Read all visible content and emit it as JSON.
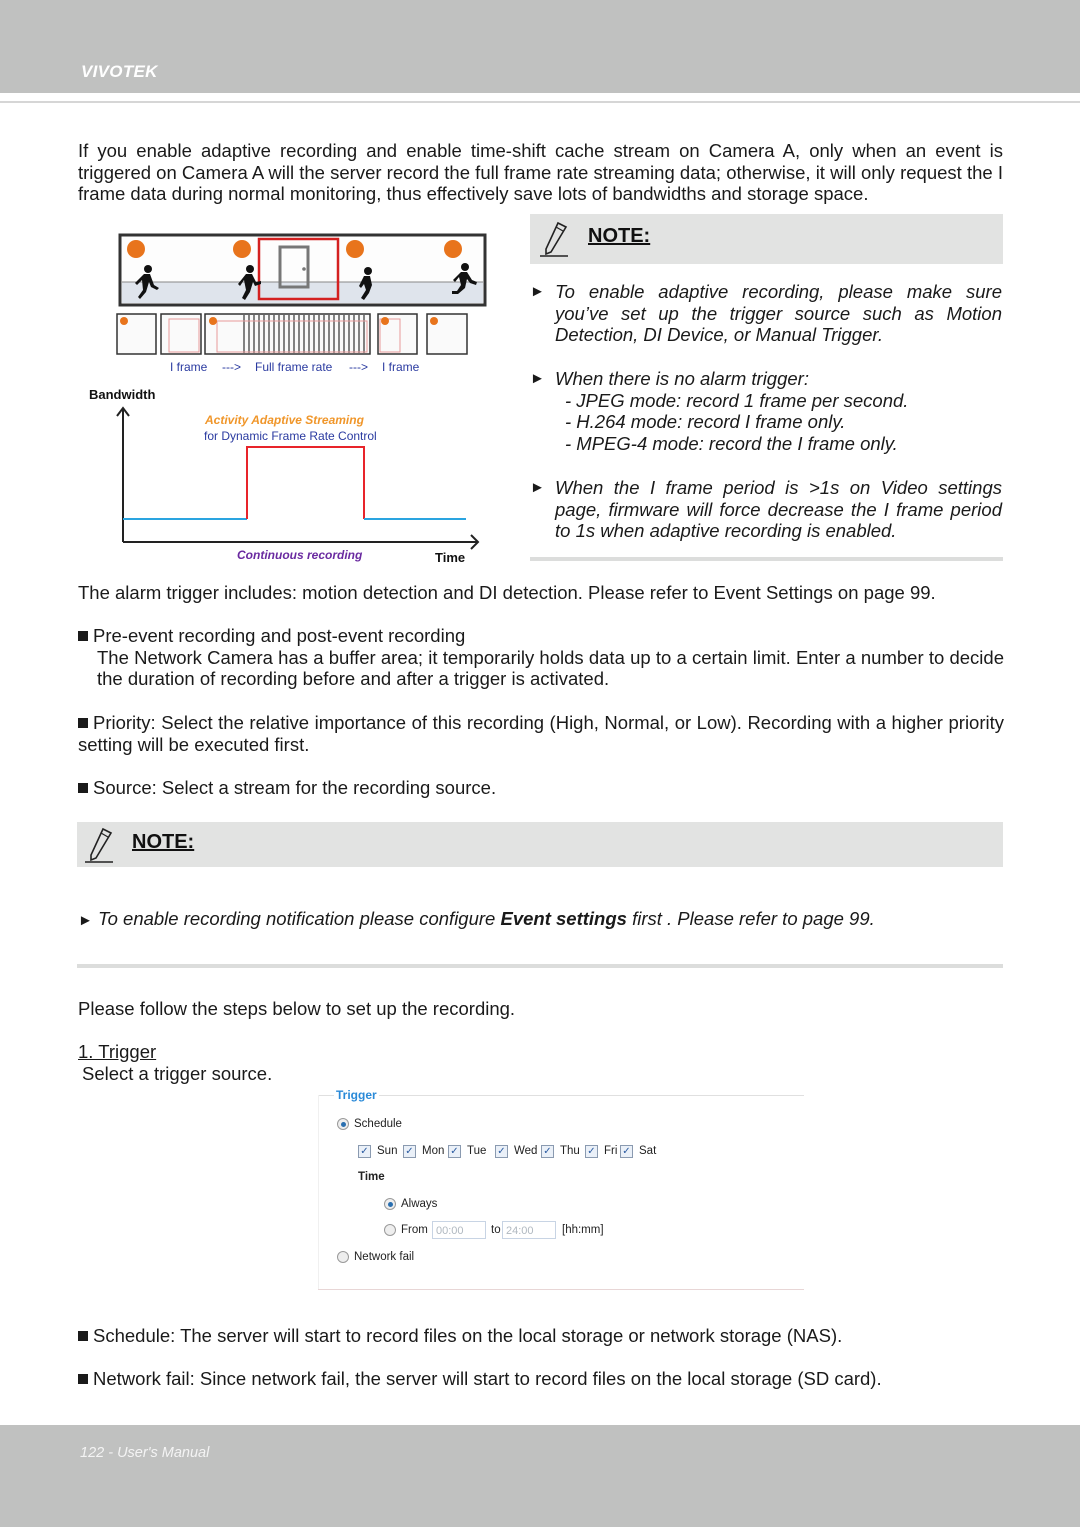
{
  "header": {
    "brand": "VIVOTEK"
  },
  "intro": "If you enable adaptive recording and enable time-shift cache stream on Camera A, only when an event is triggered on Camera A will the server record the full frame rate streaming data; otherwise, it will only request the I frame data during normal monitoring, thus effectively save lots of bandwidths and storage space.",
  "diagram": {
    "markers": [
      "1",
      "2",
      "3",
      "4"
    ],
    "frame_labels": [
      "I frame",
      "--->",
      "Full frame rate",
      "--->",
      "I frame"
    ],
    "y_axis_label": "Bandwidth",
    "x_axis_label": "Time",
    "highlight_title": "Activity Adaptive Streaming",
    "highlight_subtitle": "for Dynamic Frame Rate Control",
    "baseline_label": "Continuous recording",
    "colors": {
      "marker": "#e8741c",
      "event": "#e8242a",
      "baseline": "#2aa4e0",
      "highlight_title": "#f0962a",
      "subtitle": "#2a3aa0",
      "baseline_label": "#6a2aa0"
    }
  },
  "note1": {
    "title": "NOTE:",
    "items": [
      {
        "text": "To enable adaptive recording, please make sure you’ve set up the trigger source such as Motion Detection, DI Device, or Manual Trigger."
      },
      {
        "text": "When there is no alarm trigger:",
        "sub": [
          "- JPEG mode: record 1 frame per second.",
          "- H.264 mode: record I frame only.",
          "- MPEG-4 mode: record the I frame only."
        ]
      },
      {
        "text": "When the I frame period is >1s on Video settings page, firmware will force decrease the I frame period to 1s when adaptive recording is enabled."
      }
    ]
  },
  "alarm_text": "The alarm trigger includes: motion detection and DI detection. Please refer to Event Settings on page 99.",
  "bullets": [
    {
      "title": "Pre-event recording and post-event recording",
      "body": "The Network Camera has a buffer area; it temporarily holds data up to a certain limit. Enter a number to decide the duration of recording before and after a trigger is activated."
    },
    {
      "title": "Priority: Select the relative importance of this recording (High, Normal, or Low). Recording with a higher priority setting will be executed first."
    },
    {
      "title": "Source: Select a stream for the recording source."
    }
  ],
  "note2": {
    "title": "NOTE:",
    "text_before": "To enable recording notification please configure ",
    "text_bold": "Event settings",
    "text_after": " first . Please refer to page 99."
  },
  "steps_intro": "Please follow the steps below to set up the recording.",
  "step1": {
    "title": "1. Trigger",
    "desc": "Select a trigger source."
  },
  "trigger_panel": {
    "legend": "Trigger",
    "schedule_label": "Schedule",
    "schedule_selected": true,
    "days": [
      {
        "label": "Sun",
        "checked": true
      },
      {
        "label": "Mon",
        "checked": true
      },
      {
        "label": "Tue",
        "checked": true
      },
      {
        "label": "Wed",
        "checked": true
      },
      {
        "label": "Thu",
        "checked": true
      },
      {
        "label": "Fri",
        "checked": true
      },
      {
        "label": "Sat",
        "checked": true
      }
    ],
    "time_label": "Time",
    "always_label": "Always",
    "from_label": "From",
    "from_value": "00:00",
    "to_label": "to",
    "to_value": "24:00",
    "unit_label": "[hh:mm]",
    "network_fail_label": "Network fail"
  },
  "bottom_bullets": [
    "Schedule: The server will start to record files on the local storage or network storage (NAS).",
    "Network fail: Since network fail, the server will start to record files on the local storage (SD card)."
  ],
  "footer": {
    "page": "122 - User's Manual"
  }
}
